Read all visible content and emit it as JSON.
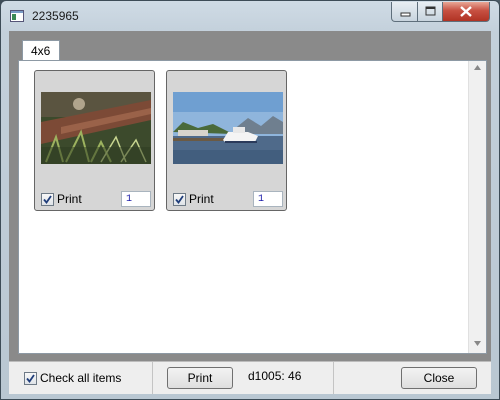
{
  "window": {
    "title": "2235965"
  },
  "tabs": [
    {
      "label": "4x6"
    }
  ],
  "cards": [
    {
      "print_label": "Print",
      "quantity": "1",
      "checked": true,
      "thumbnail": "forest-floor-photo"
    },
    {
      "print_label": "Print",
      "quantity": "1",
      "checked": true,
      "thumbnail": "harbor-boat-photo"
    }
  ],
  "footer": {
    "check_all_label": "Check all items",
    "check_all_checked": true,
    "print_button": "Print",
    "status_text": "d1005: 46",
    "close_button": "Close"
  },
  "icons": {
    "app": "window-app-icon",
    "minimize": "minimize-icon",
    "maximize": "maximize-icon",
    "close": "close-icon",
    "scroll_up": "scroll-up-arrow-icon",
    "scroll_down": "scroll-down-arrow-icon",
    "checkbox": "checkmark-icon"
  },
  "colors": {
    "close_button": "#c75042",
    "quantity_text": "#1a1aa8",
    "client_bg": "#8a8a8a"
  }
}
